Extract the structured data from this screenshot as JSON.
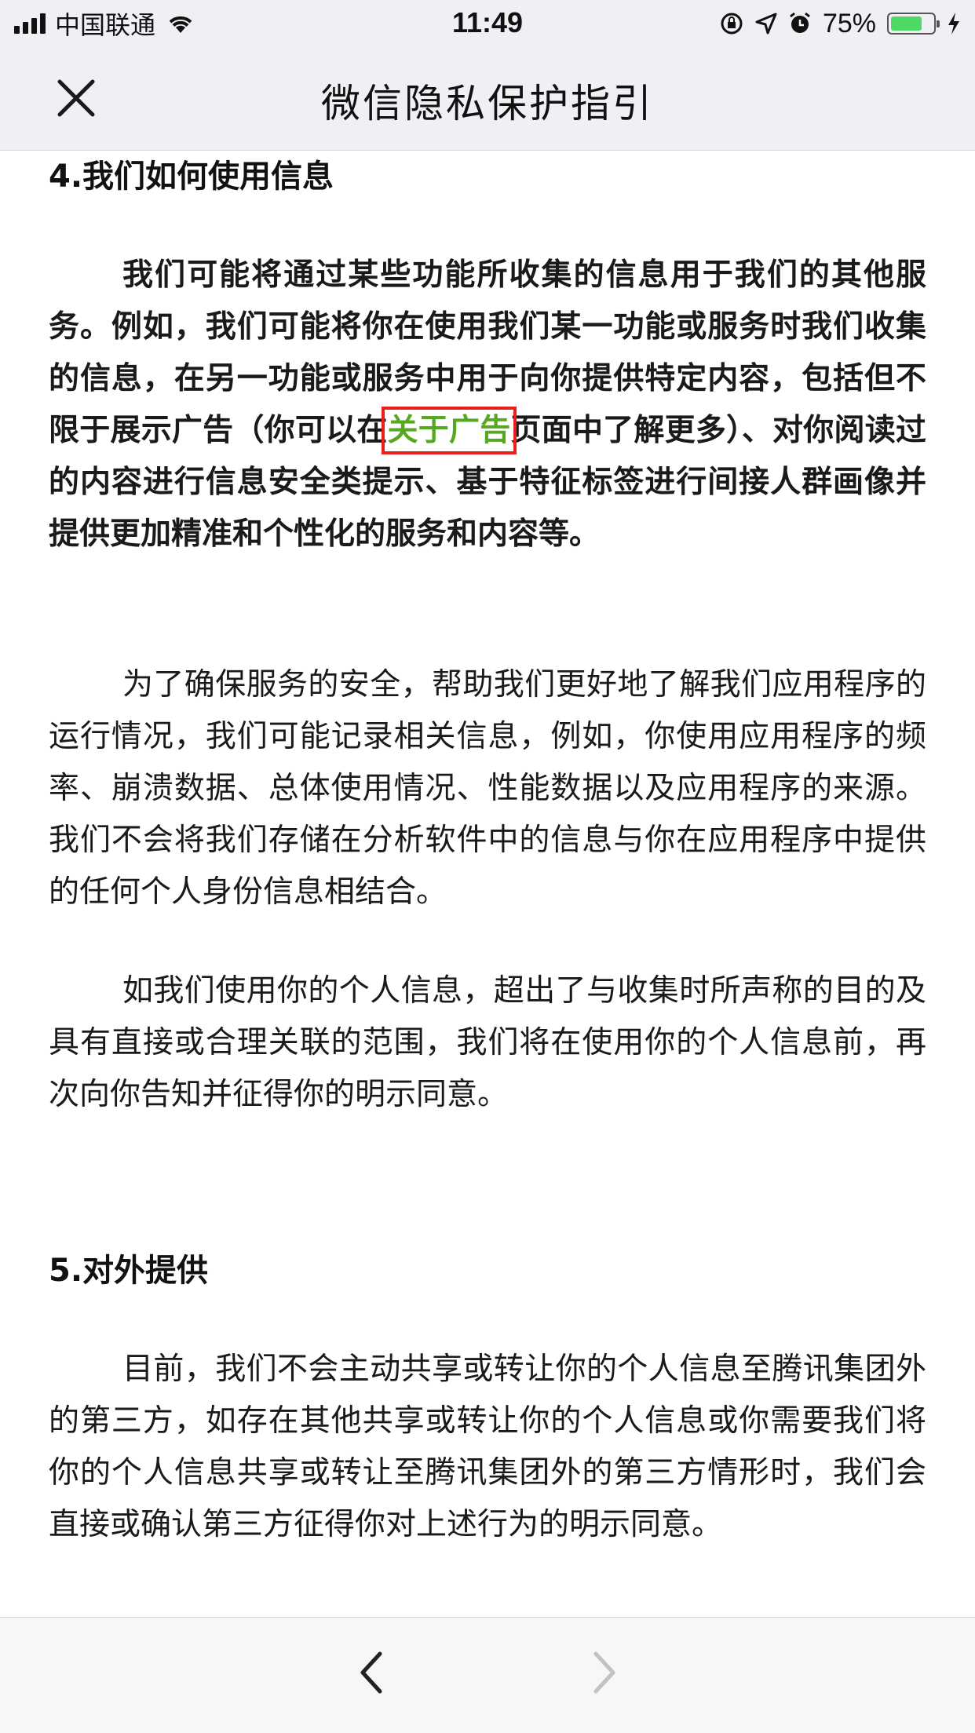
{
  "status_bar": {
    "carrier": "中国联通",
    "time": "11:49",
    "battery_percent": "75%",
    "battery_level": 0.75,
    "battery_color": "#4cd964"
  },
  "nav": {
    "title": "微信隐私保护指引",
    "close_icon": "close-icon"
  },
  "article": {
    "section4_heading": "4.我们如何使用信息",
    "p1_before": "我们可能将通过某些功能所收集的信息用于我们的其他服务。例如，我们可能将你在使用我们某一功能或服务时我们收集的信息，在另一功能或服务中用于向你提供特定内容，包括但不限于展示广告（你可以在",
    "p1_link": "关于广告",
    "p1_after": "页面中了解更多）、对你阅读过的内容进行信息安全类提示、基于特征标签进行间接人群画像并提供更加精准和个性化的服务和内容等。",
    "p2": "为了确保服务的安全，帮助我们更好地了解我们应用程序的运行情况，我们可能记录相关信息，例如，你使用应用程序的频率、崩溃数据、总体使用情况、性能数据以及应用程序的来源。我们不会将我们存储在分析软件中的信息与你在应用程序中提供的任何个人身份信息相结合。",
    "p3": "如我们使用你的个人信息，超出了与收集时所声称的目的及具有直接或合理关联的范围，我们将在使用你的个人信息前，再次向你告知并征得你的明示同意。",
    "section5_heading": "5.对外提供",
    "p4": "目前，我们不会主动共享或转让你的个人信息至腾讯集团外的第三方，如存在其他共享或转让你的个人信息或你需要我们将你的个人信息共享或转让至腾讯集团外的第三方情形时，我们会直接或确认第三方征得你对上述行为的明示同意。",
    "link_color": "#57a821",
    "highlight_color": "#e8201c"
  },
  "toolbar": {
    "back_icon": "chevron-left-icon",
    "forward_icon": "chevron-right-icon"
  }
}
